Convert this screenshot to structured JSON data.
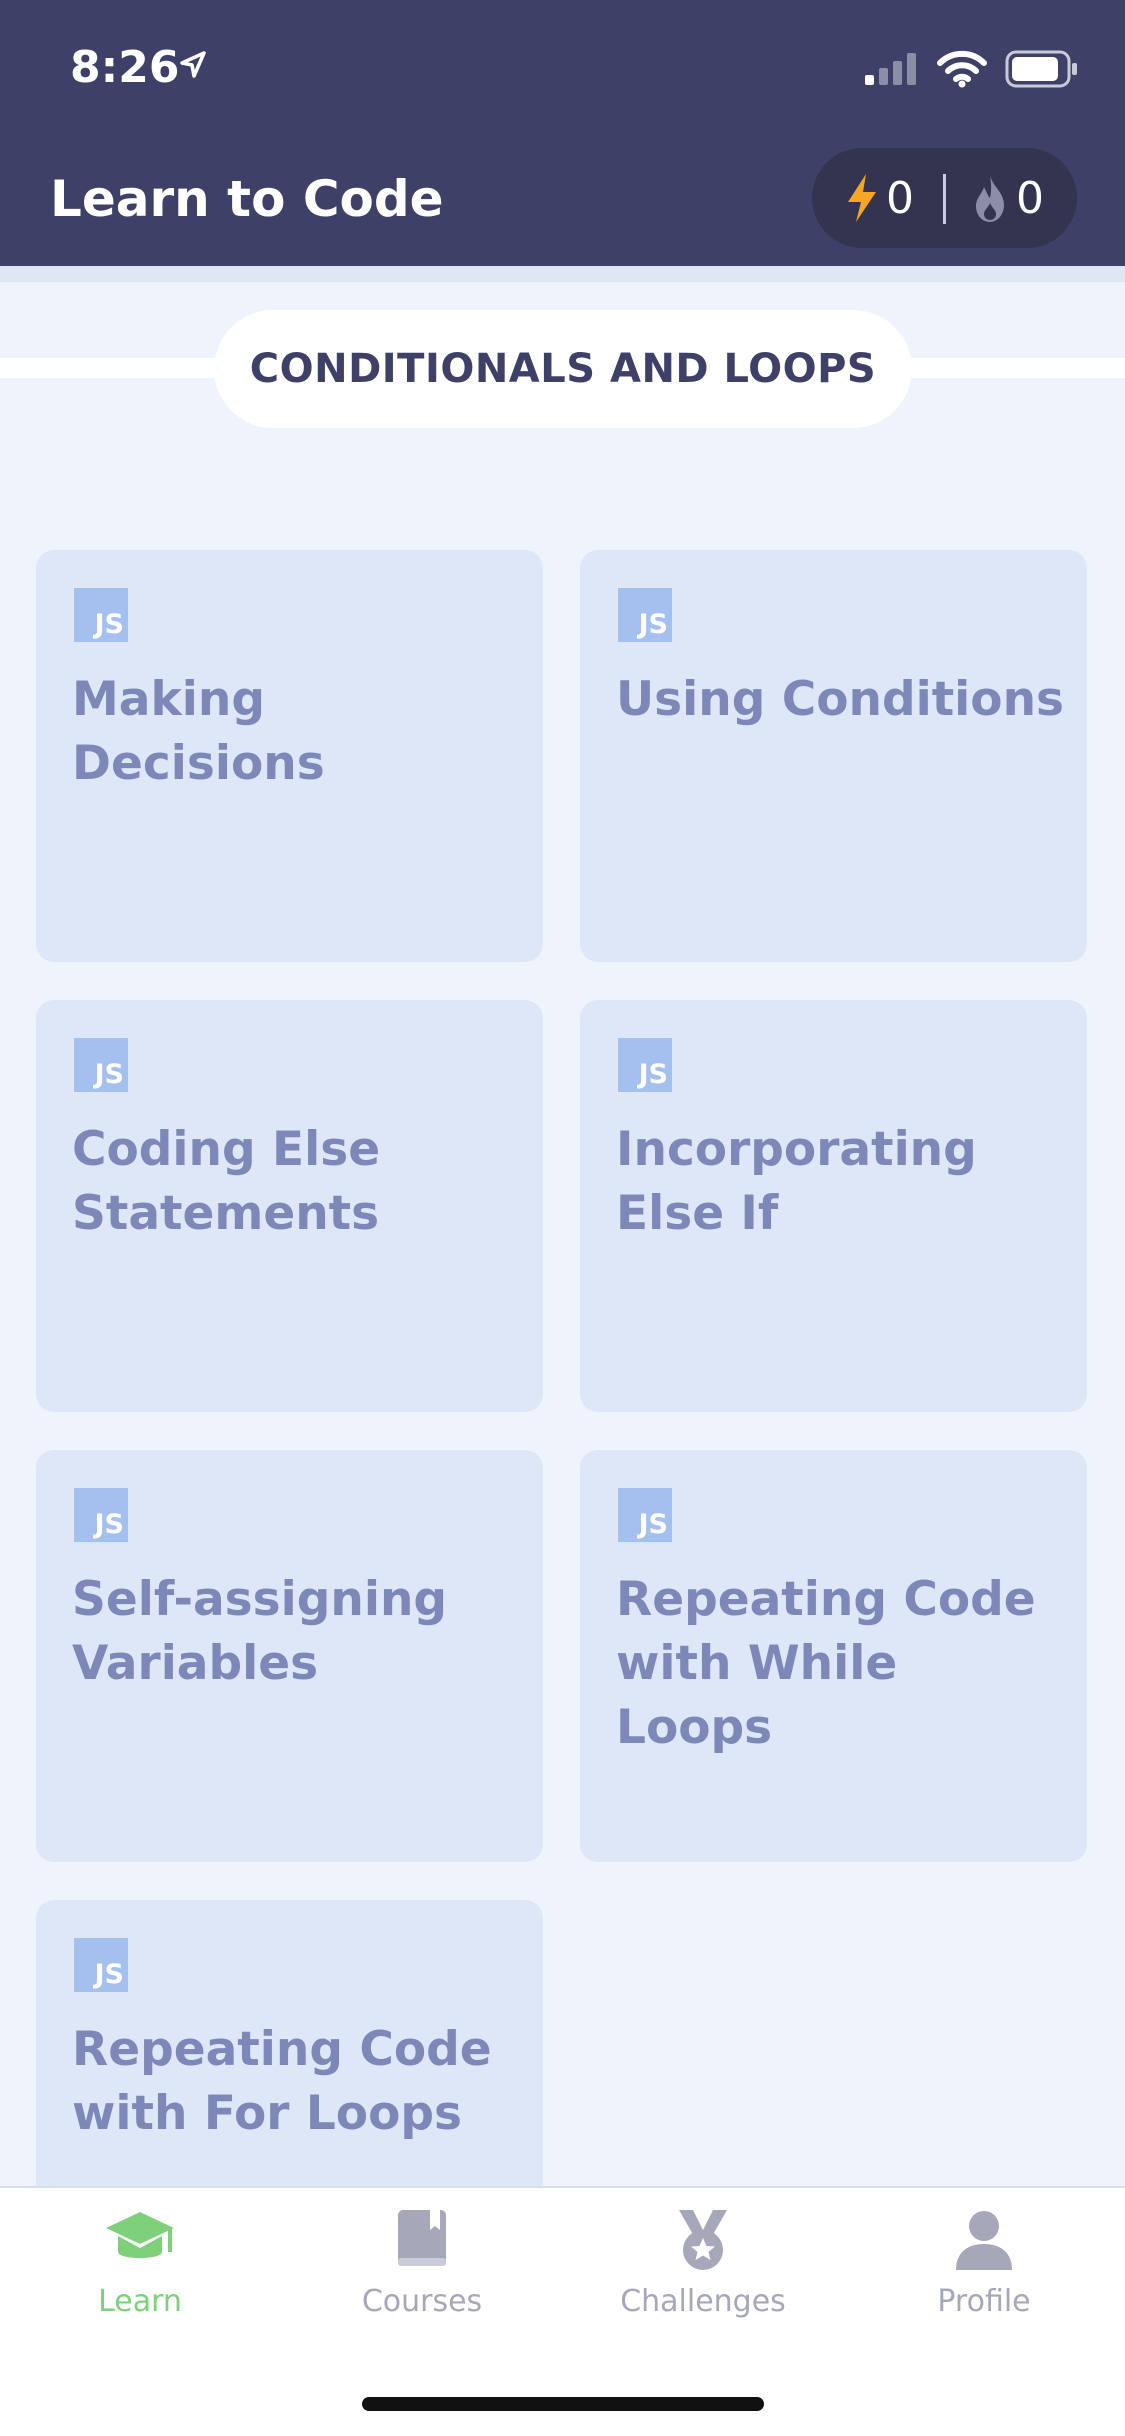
{
  "status_bar": {
    "time": "8:26"
  },
  "header": {
    "title": "Learn to Code",
    "energy_count": "0",
    "streak_count": "0"
  },
  "section": {
    "title": "CONDITIONALS AND LOOPS"
  },
  "lessons": [
    {
      "badge": "JS",
      "title": "Making Decisions"
    },
    {
      "badge": "JS",
      "title": "Using Conditions"
    },
    {
      "badge": "JS",
      "title": "Coding Else Statements"
    },
    {
      "badge": "JS",
      "title": "Incorporating Else If"
    },
    {
      "badge": "JS",
      "title": "Self-assigning Variables"
    },
    {
      "badge": "JS",
      "title": "Repeating Code with While Loops"
    },
    {
      "badge": "JS",
      "title": "Repeating Code with For Loops"
    }
  ],
  "tabs": [
    {
      "label": "Learn",
      "icon": "graduation-cap-icon",
      "active": true
    },
    {
      "label": "Courses",
      "icon": "book-icon",
      "active": false
    },
    {
      "label": "Challenges",
      "icon": "medal-icon",
      "active": false
    },
    {
      "label": "Profile",
      "icon": "person-icon",
      "active": false
    }
  ],
  "colors": {
    "header_bg": "#3f4068",
    "page_bg": "#eff4fc",
    "card_bg": "#dde7f7",
    "card_text": "#7e88b8",
    "js_badge": "#a4c0ee",
    "active_tab": "#7ed17a",
    "energy": "#f5a623"
  }
}
